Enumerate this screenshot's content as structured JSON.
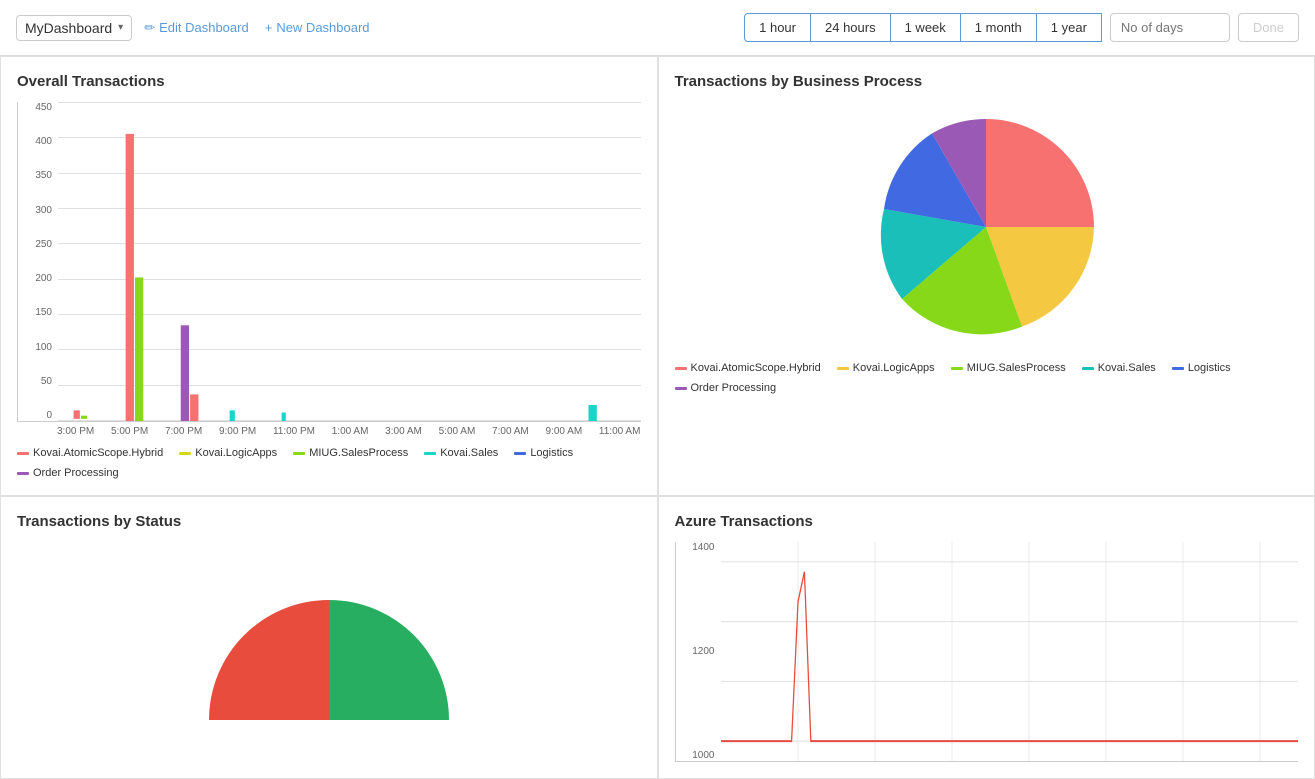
{
  "header": {
    "dashboard_name": "MyDashboard",
    "edit_label": "Edit Dashboard",
    "new_label": "New Dashboard",
    "time_filters": [
      {
        "id": "1h",
        "label": "1 hour"
      },
      {
        "id": "24h",
        "label": "24 hours"
      },
      {
        "id": "1w",
        "label": "1 week"
      },
      {
        "id": "1m",
        "label": "1 month"
      },
      {
        "id": "1y",
        "label": "1 year"
      }
    ],
    "days_placeholder": "No of days",
    "done_label": "Done"
  },
  "panels": {
    "overall_transactions": {
      "title": "Overall Transactions",
      "y_labels": [
        "450",
        "400",
        "350",
        "300",
        "250",
        "200",
        "150",
        "100",
        "50",
        "0"
      ],
      "x_labels": [
        "3:00 PM",
        "5:00 PM",
        "7:00 PM",
        "9:00 PM",
        "11:00 PM",
        "1:00 AM",
        "3:00 AM",
        "5:00 AM",
        "7:00 AM",
        "9:00 AM",
        "11:00 AM"
      ],
      "legend": [
        {
          "label": "Kovai.AtomicScope.Hybrid",
          "color": "#f87171"
        },
        {
          "label": "Kovai.LogicApps",
          "color": "#d4d819"
        },
        {
          "label": "MIUG.SalesProcess",
          "color": "#86d819"
        },
        {
          "label": "Kovai.Sales",
          "color": "#19d4c8"
        },
        {
          "label": "Logistics",
          "color": "#4169e1"
        },
        {
          "label": "Order Processing",
          "color": "#9b59b6"
        }
      ]
    },
    "transactions_by_business": {
      "title": "Transactions by Business Process",
      "legend": [
        {
          "label": "Kovai.AtomicScope.Hybrid",
          "color": "#f87171"
        },
        {
          "label": "Kovai.LogicApps",
          "color": "#d4d819"
        },
        {
          "label": "MIUG.SalesProcess",
          "color": "#86d819"
        },
        {
          "label": "Kovai.Sales",
          "color": "#19d4c8"
        },
        {
          "label": "Logistics",
          "color": "#4169e1"
        },
        {
          "label": "Order Processing",
          "color": "#9b59b6"
        }
      ]
    },
    "transactions_by_status": {
      "title": "Transactions by Status"
    },
    "azure_transactions": {
      "title": "Azure Transactions",
      "y_labels": [
        "1400",
        "1200",
        "1000"
      ]
    }
  },
  "colors": {
    "accent": "#5b9bd5",
    "red": "#f87171",
    "yellow": "#d4d819",
    "green": "#86d819",
    "teal": "#19d4c8",
    "blue": "#4169e1",
    "purple": "#9b59b6",
    "orange": "#f5a623",
    "coral": "#e74c3c"
  }
}
